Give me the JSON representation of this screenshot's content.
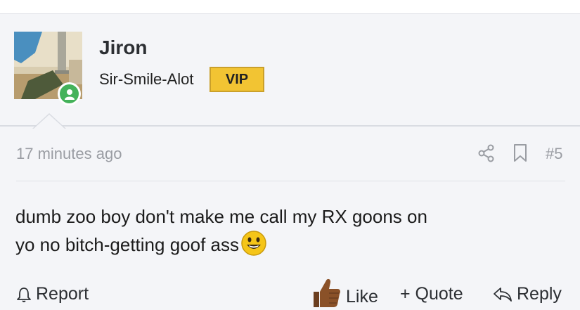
{
  "post": {
    "username": "Jiron",
    "user_title": "Sir-Smile-Alot",
    "badge": "VIP",
    "timestamp": "17 minutes ago",
    "post_number": "#5",
    "message_line1": "dumb zoo boy don't make me call my RX goons on",
    "message_line2": "yo no bitch-getting goof ass",
    "message_emoji": "smiley-emoji"
  },
  "actions": {
    "report_label": "Report",
    "like_label": "Like",
    "quote_label": "+ Quote",
    "reply_label": "Reply"
  },
  "colors": {
    "badge_bg": "#f2c433",
    "online_dot": "#44b25a",
    "muted_text": "#9a9da3"
  }
}
